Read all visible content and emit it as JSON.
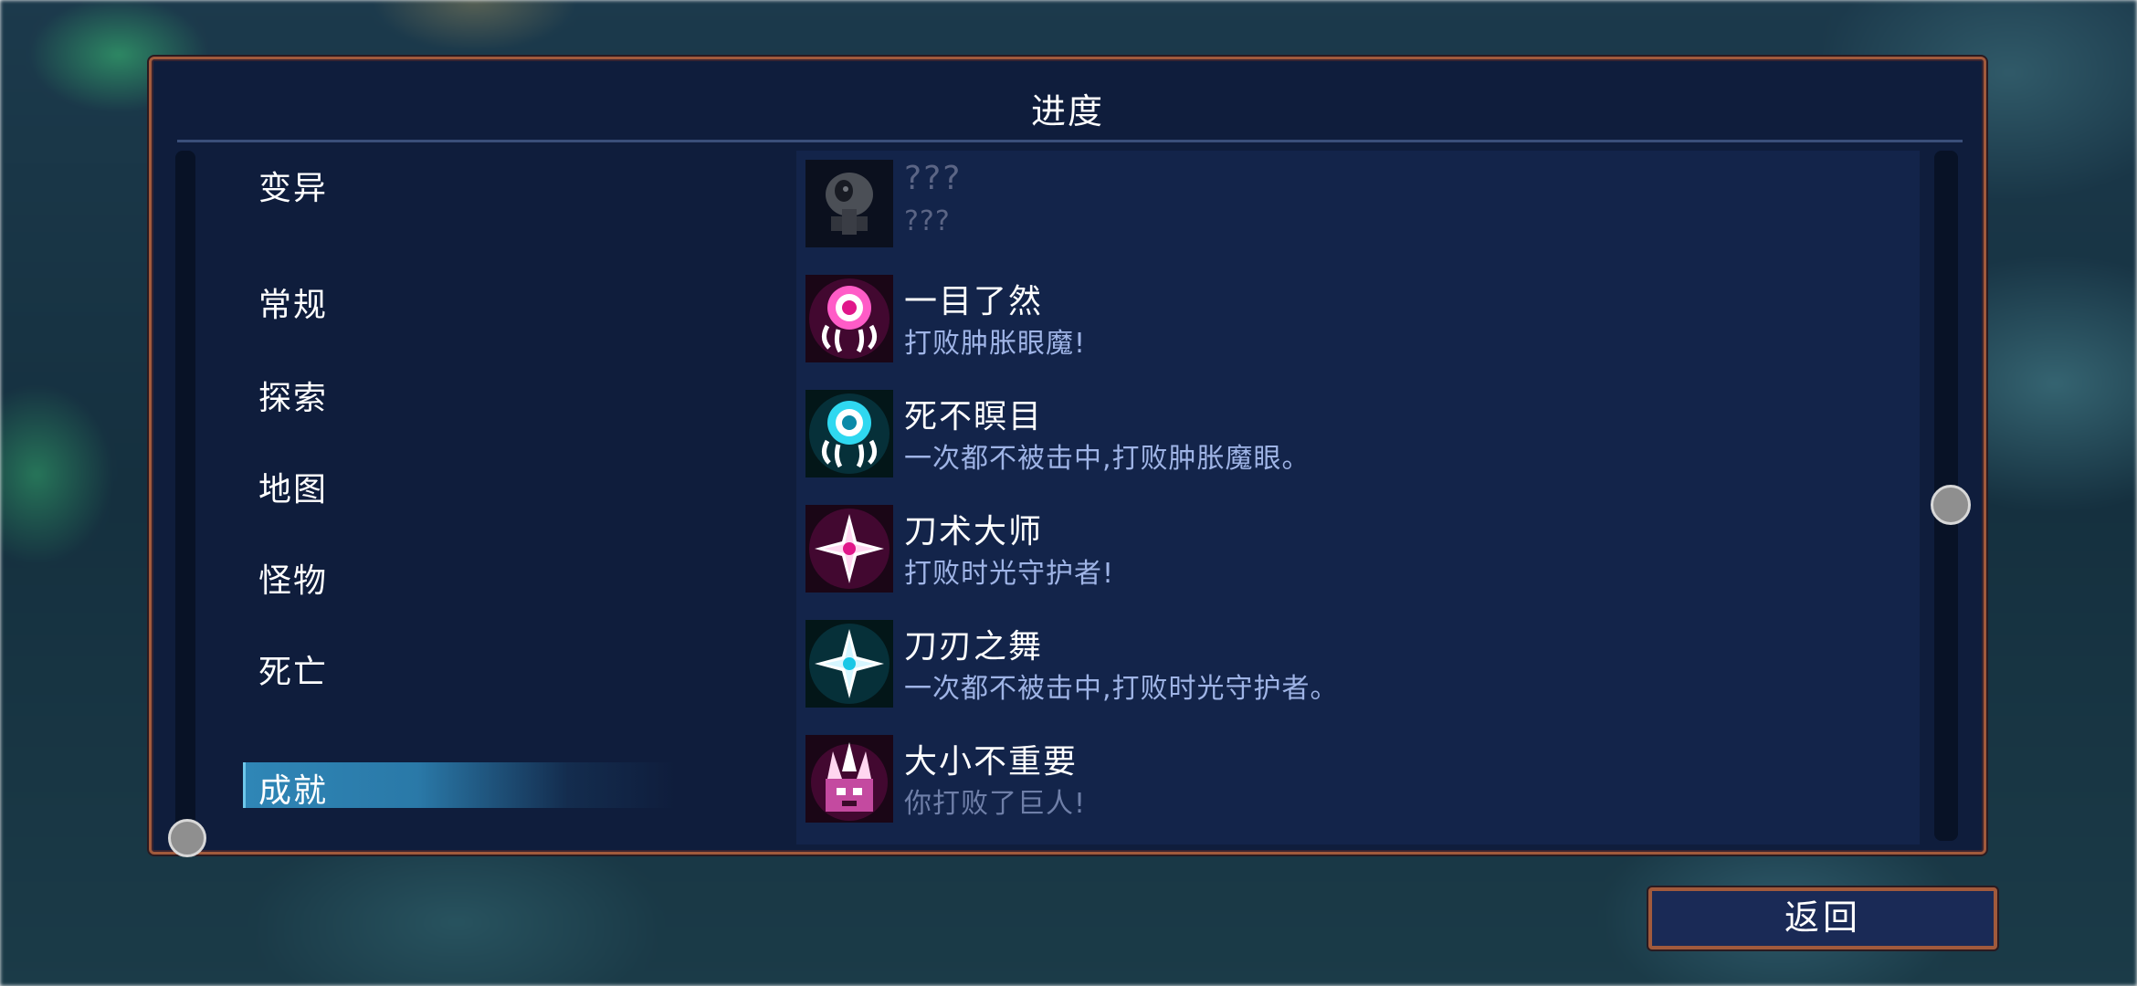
{
  "panel": {
    "title": "进度"
  },
  "categories": [
    {
      "label": "变异",
      "selected": false
    },
    {
      "label": "常规",
      "selected": false
    },
    {
      "label": "探索",
      "selected": false
    },
    {
      "label": "地图",
      "selected": false
    },
    {
      "label": "怪物",
      "selected": false
    },
    {
      "label": "死亡",
      "selected": false
    },
    {
      "label": "成就",
      "selected": true
    }
  ],
  "achievements": [
    {
      "name": "???",
      "desc": "???",
      "icon": "locked-ghost-icon",
      "locked": true
    },
    {
      "name": "一目了然",
      "desc": "打败肿胀眼魔!",
      "icon": "pink-eye-monster-icon",
      "locked": false
    },
    {
      "name": "死不瞑目",
      "desc": "一次都不被击中,打败肿胀魔眼。",
      "icon": "cyan-eye-monster-icon",
      "locked": false
    },
    {
      "name": "刀术大师",
      "desc": "打败时光守护者!",
      "icon": "pink-shuriken-icon",
      "locked": false
    },
    {
      "name": "刀刃之舞",
      "desc": "一次都不被击中,打败时光守护者。",
      "icon": "cyan-shuriken-icon",
      "locked": false
    },
    {
      "name": "大小不重要",
      "desc": "你打败了巨人!",
      "icon": "pink-giant-icon",
      "locked": false
    }
  ],
  "buttons": {
    "back_label": "返回"
  },
  "colors": {
    "panel_bg": "#0f1d3c",
    "border": "#a15a3c",
    "selected_tab": "#2f86b6",
    "desc_text": "#9fb4e6",
    "pink_glow": "#e0178a",
    "cyan_glow": "#19c7e6"
  }
}
